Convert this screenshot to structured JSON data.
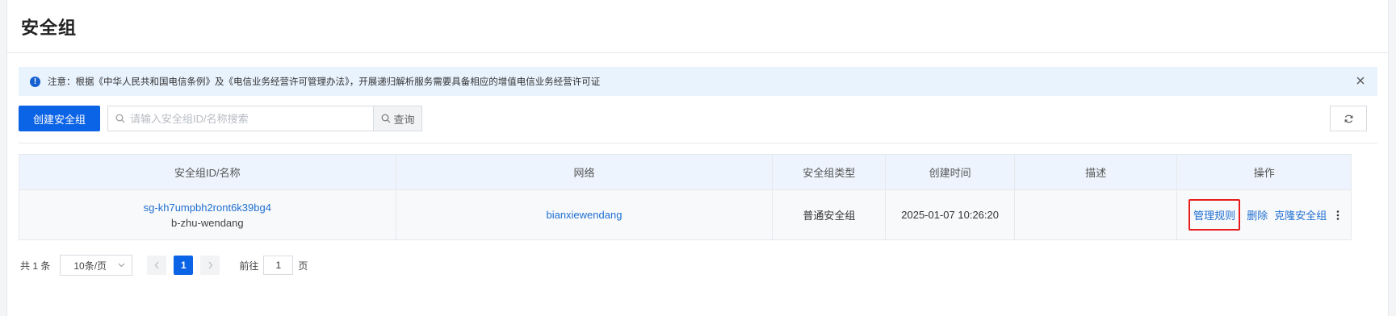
{
  "page": {
    "title": "安全组"
  },
  "notice": {
    "text": "注意：根据《中华人民共和国电信条例》及《电信业务经营许可管理办法》，开展递归解析服务需要具备相应的增值电信业务经营许可证"
  },
  "toolbar": {
    "create_label": "创建安全组",
    "search_placeholder": "请输入安全组ID/名称搜索",
    "query_label": "查询"
  },
  "table": {
    "columns": [
      "安全组ID/名称",
      "网络",
      "安全组类型",
      "创建时间",
      "描述",
      "操作"
    ],
    "rows": [
      {
        "id": "sg-kh7umpbh2ront6k39bg4",
        "name": "b-zhu-wendang",
        "network": "bianxiewendang",
        "type": "普通安全组",
        "created": "2025-01-07 10:26:20",
        "description": "",
        "actions": {
          "manage": "管理规则",
          "delete": "删除",
          "clone": "克隆安全组"
        }
      }
    ]
  },
  "pagination": {
    "total": "共 1 条",
    "page_size": "10条/页",
    "current": "1",
    "goto_label": "前往",
    "goto_value": "1",
    "goto_suffix": "页"
  },
  "colors": {
    "primary": "#0b63e5",
    "link": "#1f6fd0",
    "highlight": "#e81c1c",
    "notice_bg": "#e9f3fe"
  }
}
